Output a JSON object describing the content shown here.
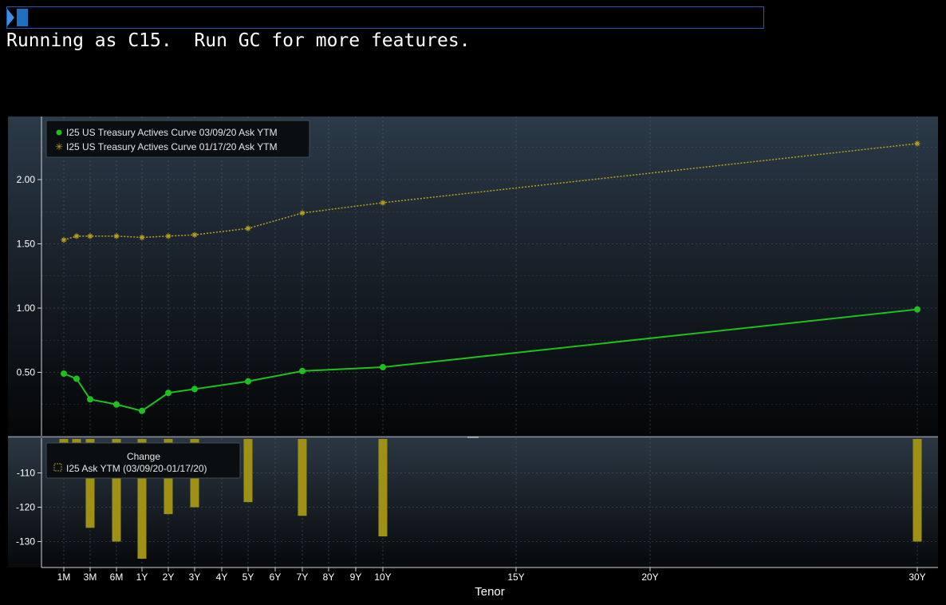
{
  "command_bar": {
    "value": "",
    "placeholder": ""
  },
  "status_message": "Running as C15.  Run GC for more features.",
  "colors": {
    "current": "#1dc01d",
    "previous": "#b8a219",
    "change_bar": "#9e9116",
    "axis_text": "#ffffff"
  },
  "chart_data": [
    {
      "type": "line",
      "title": "",
      "xlabel": "Tenor",
      "ylabel": "",
      "ylim": [
        0.1,
        2.4
      ],
      "yticks": [
        0.5,
        1.0,
        1.5,
        2.0
      ],
      "ytick_labels": [
        "0.50",
        "1.00",
        "1.50",
        "2.00"
      ],
      "grid": true,
      "legend_position": "top-left",
      "x_tenors": [
        0.0833,
        0.25,
        0.5,
        1,
        2,
        3,
        5,
        7,
        10,
        30
      ],
      "series": [
        {
          "name": "I25 US Treasury Actives Curve 03/09/20 Ask YTM",
          "marker": "circle",
          "values": [
            0.49,
            0.45,
            0.29,
            0.25,
            0.2,
            0.34,
            0.37,
            0.43,
            0.51,
            0.54,
            0.99
          ]
        },
        {
          "name": "I25 US Treasury Actives Curve 01/17/20 Ask YTM",
          "marker": "star",
          "values": [
            1.53,
            1.56,
            1.56,
            1.56,
            1.55,
            1.56,
            1.57,
            1.62,
            1.74,
            1.82,
            2.28
          ]
        }
      ]
    },
    {
      "type": "bar",
      "title": "Change",
      "xlabel": "Tenor",
      "ylabel": "",
      "ylim": [
        -137,
        -99
      ],
      "yticks": [
        -110,
        -120,
        -130
      ],
      "ytick_labels": [
        "-110",
        "-120",
        "-130"
      ],
      "grid": true,
      "legend_position": "top-left",
      "series": [
        {
          "name": "I25 Ask YTM (03/09/20-01/17/20)",
          "values": [
            -103,
            -111,
            -126,
            -130,
            -135,
            -122,
            -120,
            -118.5,
            -122.5,
            -128.5,
            -130
          ]
        }
      ]
    }
  ],
  "x_axis": {
    "tick_labels": [
      "1M",
      "3M",
      "6M",
      "1Y",
      "2Y",
      "3Y",
      "4Y",
      "5Y",
      "6Y",
      "7Y",
      "8Y",
      "9Y",
      "10Y",
      "15Y",
      "20Y",
      "30Y"
    ],
    "label": "Tenor"
  }
}
